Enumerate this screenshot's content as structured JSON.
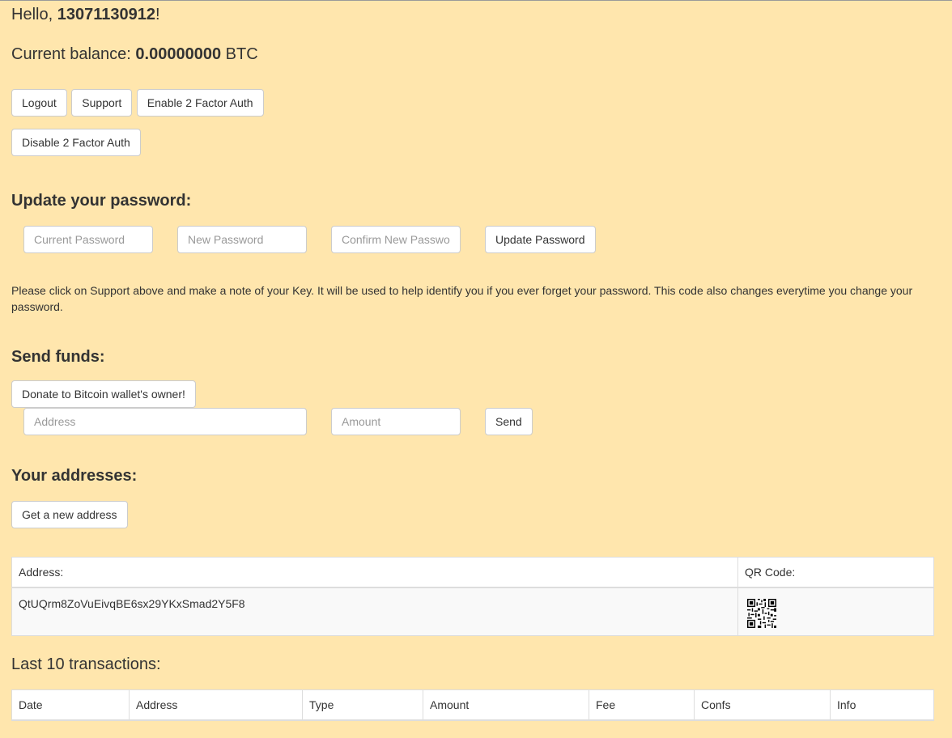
{
  "greeting": {
    "prefix": "Hello, ",
    "username": "13071130912",
    "suffix": "!"
  },
  "balance": {
    "label": "Current balance: ",
    "amount": "0.00000000",
    "unit": " BTC"
  },
  "buttons": {
    "logout": "Logout",
    "support": "Support",
    "enable_2fa": "Enable 2 Factor Auth",
    "disable_2fa": "Disable 2 Factor Auth"
  },
  "update_password": {
    "heading": "Update your password:",
    "current_placeholder": "Current Password",
    "new_placeholder": "New Password",
    "confirm_placeholder": "Confirm New Passwo",
    "submit": "Update Password"
  },
  "note": "Please click on Support above and make a note of your Key. It will be used to help identify you if you ever forget your password. This code also changes everytime you change your password.",
  "send_funds": {
    "heading": "Send funds:",
    "donate": "Donate to Bitcoin wallet's owner!",
    "address_placeholder": "Address",
    "amount_placeholder": "Amount",
    "send": "Send"
  },
  "addresses": {
    "heading": "Your addresses:",
    "new_address": "Get a new address",
    "columns": [
      "Address:",
      "QR Code:"
    ],
    "rows": [
      {
        "address": "QtUQrm8ZoVuEivqBE6sx29YKxSmad2Y5F8",
        "qr_icon": "qr-code-icon"
      }
    ]
  },
  "transactions": {
    "heading": "Last 10 transactions:",
    "columns": [
      "Date",
      "Address",
      "Type",
      "Amount",
      "Fee",
      "Confs",
      "Info"
    ]
  }
}
